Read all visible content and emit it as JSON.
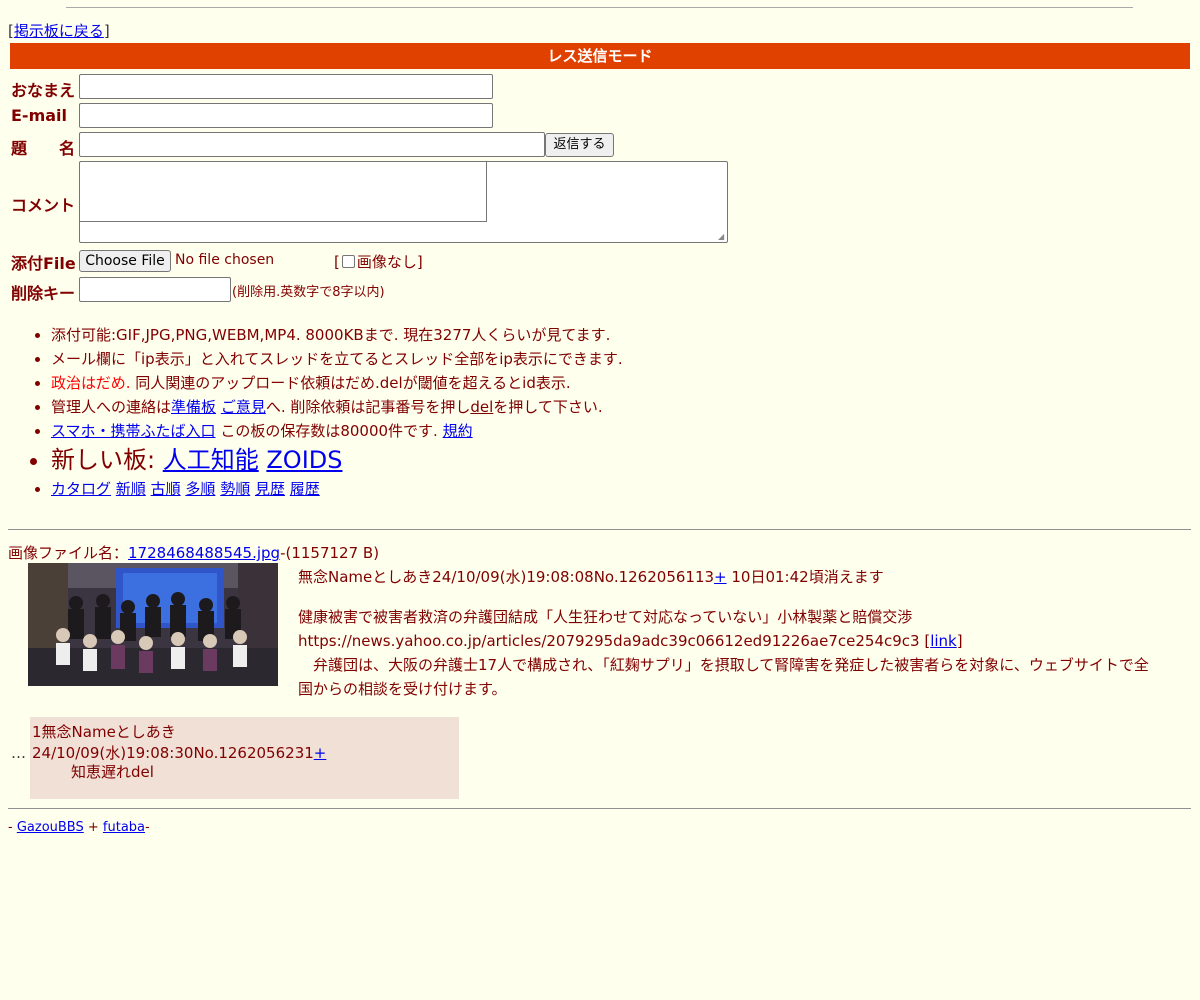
{
  "nav": {
    "back_open": "[",
    "back_link": "掲示板に戻る",
    "back_close": "]"
  },
  "form": {
    "mode_title": "レス送信モード",
    "name_label": "おなまえ",
    "email_label": "E-mail",
    "subject_label": "題　　名",
    "submit_label": "返信する",
    "comment_label": "コメント",
    "file_label": "添付File",
    "file_button": "Choose File",
    "file_status": "No file chosen",
    "noimage_open": "[",
    "noimage_label": "画像なし",
    "noimage_close": "]",
    "delkey_label": "削除キー",
    "delkey_hint": "(削除用.英数字で8字以内)"
  },
  "rules": {
    "r1": "添付可能:GIF,JPG,PNG,WEBM,MP4. 8000KBまで. 現在3277人くらいが見てます.",
    "r2": "メール欄に「ip表示」と入れてスレッドを立てるとスレッド全部をip表示にできます.",
    "r3_red": "政治はだめ.",
    "r3_rest": " 同人関連のアップロード依頼はだめ.delが閾値を超えるとid表示.",
    "r4_pre": "管理人への連絡は",
    "r4_link1": "準備板",
    "r4_link2": "ご意見",
    "r4_mid": "へ. 削除依頼は記事番号を押し",
    "r4_del": "del",
    "r4_post": "を押して下さい.",
    "r5_link": "スマホ・携帯ふたば入口",
    "r5_mid": " この板の保存数は80000件です. ",
    "r5_link2": "規約",
    "r6_pre": "新しい板: ",
    "r6_link1": "人工知能",
    "r6_link2": "ZOIDS",
    "r7": [
      "カタログ",
      "新順",
      "古順",
      "多順",
      "勢順",
      "見歴",
      "履歴"
    ]
  },
  "thread": {
    "imginfo_pre": "画像ファイル名：",
    "filename": "1728468488545.jpg",
    "filesize": "-(1157127 B)",
    "header": "無念Nameとしあき24/10/09(水)19:08:08No.1262056113",
    "plus": "+",
    "expire": " 10日01:42頃消えます",
    "body1": "健康被害で被害者救済の弁護団結成「人生狂わせて対応なっていない」小林製薬と賠償交渉",
    "body2": "https://news.yahoo.co.jp/articles/2079295da9adc39c06612ed91226ae7ce254c9c3",
    "link_open": " [",
    "link_label": "link",
    "link_close": "]",
    "body3": "　弁護団は、大阪の弁護士17人で構成され、「紅麹サプリ」を摂取して腎障害を発症した被害者らを対象に、ウェブサイトで全国からの相談を受け付けます。"
  },
  "reply": {
    "dots": "…",
    "header": "1無念Nameとしあき24/10/09(水)19:08:30No.1262056231",
    "plus": "+",
    "body": "知恵遅れdel"
  },
  "footer": {
    "pre": "- ",
    "link1": "GazouBBS",
    "mid": " + ",
    "link2": "futaba",
    "post": "-"
  }
}
